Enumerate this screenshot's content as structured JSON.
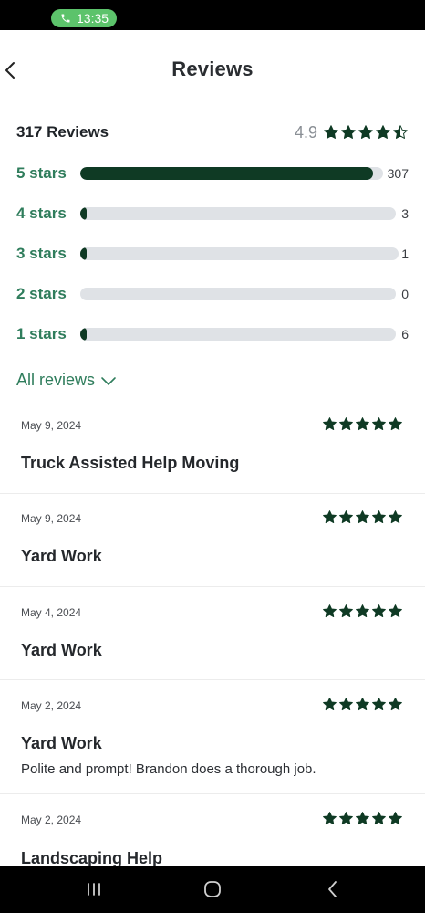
{
  "status_bar": {
    "time": "13:35",
    "call_color": "#5cc36b"
  },
  "header": {
    "title": "Reviews"
  },
  "summary": {
    "count_label": "317 Reviews",
    "average": "4.9",
    "star_rating": 4.9
  },
  "distribution": [
    {
      "label": "5 stars",
      "count": "307",
      "fraction": 0.968
    },
    {
      "label": "4 stars",
      "count": "3",
      "fraction": 0.009
    },
    {
      "label": "3 stars",
      "count": "1",
      "fraction": 0.003
    },
    {
      "label": "2 stars",
      "count": "0",
      "fraction": 0.0
    },
    {
      "label": "1 stars",
      "count": "6",
      "fraction": 0.019
    }
  ],
  "all_reviews": {
    "label": "All reviews"
  },
  "reviews": [
    {
      "date": "May 9, 2024",
      "title": "Truck Assisted Help Moving",
      "text": "",
      "stars": 5
    },
    {
      "date": "May 9, 2024",
      "title": "Yard Work",
      "text": "",
      "stars": 5
    },
    {
      "date": "May 4, 2024",
      "title": "Yard Work",
      "text": "",
      "stars": 5
    },
    {
      "date": "May 2, 2024",
      "title": "Yard Work",
      "text": "Polite and prompt! Brandon does a thorough job.",
      "stars": 5
    },
    {
      "date": "May 2, 2024",
      "title": "Landscaping Help",
      "text": "",
      "stars": 5
    }
  ],
  "colors": {
    "accent": "#2f7d5c",
    "bar_fill": "#0f3a24",
    "bar_track": "#dfe2e6",
    "star": "#0f3a24"
  }
}
